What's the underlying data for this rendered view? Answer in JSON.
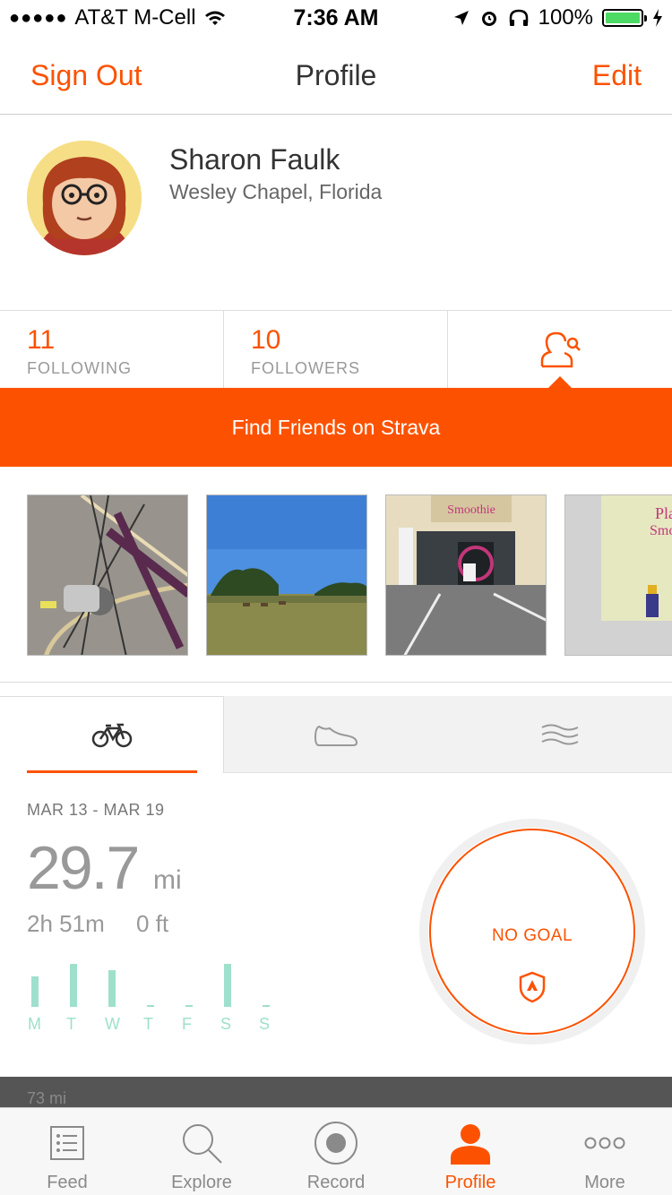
{
  "status_bar": {
    "carrier": "AT&T M-Cell",
    "time": "7:36 AM",
    "battery": "100%"
  },
  "navbar": {
    "left": "Sign Out",
    "title": "Profile",
    "right": "Edit"
  },
  "profile": {
    "name": "Sharon Faulk",
    "location": "Wesley Chapel, Florida"
  },
  "stats": {
    "following_count": "11",
    "following_label": "FOLLOWING",
    "followers_count": "10",
    "followers_label": "FOLLOWERS"
  },
  "banner": {
    "label": "Find Friends on Strava"
  },
  "sport_tabs": [
    "ride",
    "run",
    "swim"
  ],
  "weekly": {
    "range": "MAR 13 - MAR 19",
    "distance": "29.7",
    "unit": "mi",
    "time": "2h 51m",
    "elevation": "0 ft",
    "days": [
      "M",
      "T",
      "W",
      "T",
      "F",
      "S",
      "S"
    ],
    "activity_levels": [
      0.7,
      1.0,
      0.85,
      0,
      0,
      1.0,
      0
    ],
    "goal": "NO GOAL"
  },
  "strip_text": "73 mi",
  "tab_bar": {
    "items": [
      "Feed",
      "Explore",
      "Record",
      "Profile",
      "More"
    ],
    "active": "Profile"
  },
  "colors": {
    "accent": "#fc5200",
    "bars": "#9ee0cc"
  }
}
